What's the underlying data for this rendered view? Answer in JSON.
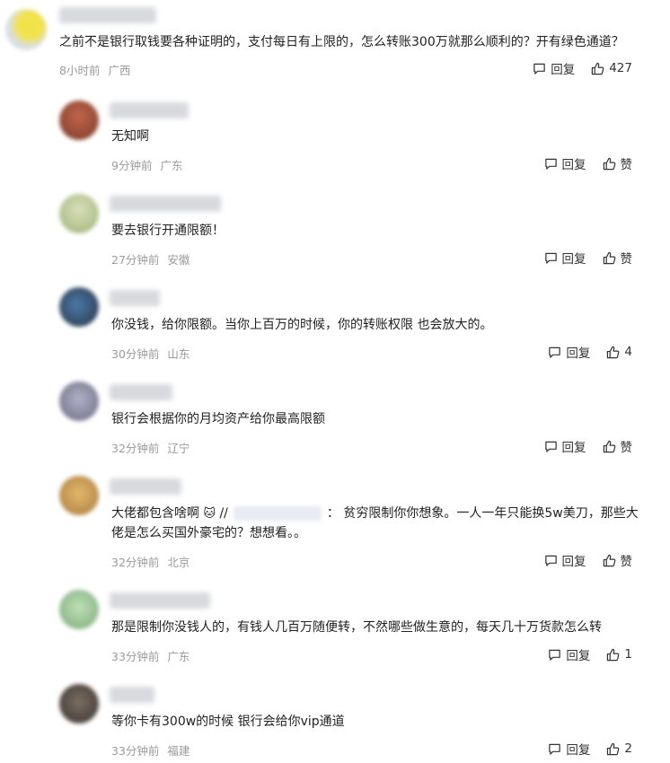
{
  "main_comment": {
    "text": "之前不是银行取钱要各种证明的，支付每日有上限的，怎么转账300万就那么顺利的？开有绿色通道？",
    "time": "8小时前",
    "location": "广西",
    "reply_label": "回复",
    "like_count": "427",
    "avatar_color": "#e0d23a"
  },
  "replies": [
    {
      "text": "无知啊",
      "time": "9分钟前",
      "location": "广东",
      "reply_label": "回复",
      "like_label": "赞",
      "avatar_color": "#a0503a"
    },
    {
      "text": "要去银行开通限额！",
      "time": "27分钟前",
      "location": "安徽",
      "reply_label": "回复",
      "like_label": "赞",
      "avatar_color": "#b9c79a"
    },
    {
      "text": "你没钱，给你限额。当你上百万的时候，你的转账权限 也会放大的。",
      "time": "30分钟前",
      "location": "山东",
      "reply_label": "回复",
      "like_label": "4",
      "avatar_color": "#3a4f63"
    },
    {
      "text": "银行会根据你的月均资产给你最高限额",
      "time": "32分钟前",
      "location": "辽宁",
      "reply_label": "回复",
      "like_label": "赞",
      "avatar_color": "#8e8ea0"
    },
    {
      "text_a": "大佬都包含啥啊",
      "emoji": "🐱",
      "text_b": "//",
      "text_c": "：  贫穷限制你你想象。一人一年只能换5w美刀，那些大",
      "text_d": "佬是怎么买国外豪宅的？想想看。。",
      "time": "32分钟前",
      "location": "北京",
      "reply_label": "回复",
      "like_label": "赞",
      "avatar_color": "#c89a5a"
    },
    {
      "text": "那是限制你没钱人的，有钱人几百万随便转，不然哪些做生意的，每天几十万货款怎么转",
      "time": "33分钟前",
      "location": "广东",
      "reply_label": "回复",
      "like_label": "1",
      "avatar_color": "#8cb58a"
    },
    {
      "text": "等你卡有300w的时候 银行会给你vip通道",
      "time": "33分钟前",
      "location": "福建",
      "reply_label": "回复",
      "like_label": "2",
      "avatar_color": "#5a5048"
    }
  ]
}
